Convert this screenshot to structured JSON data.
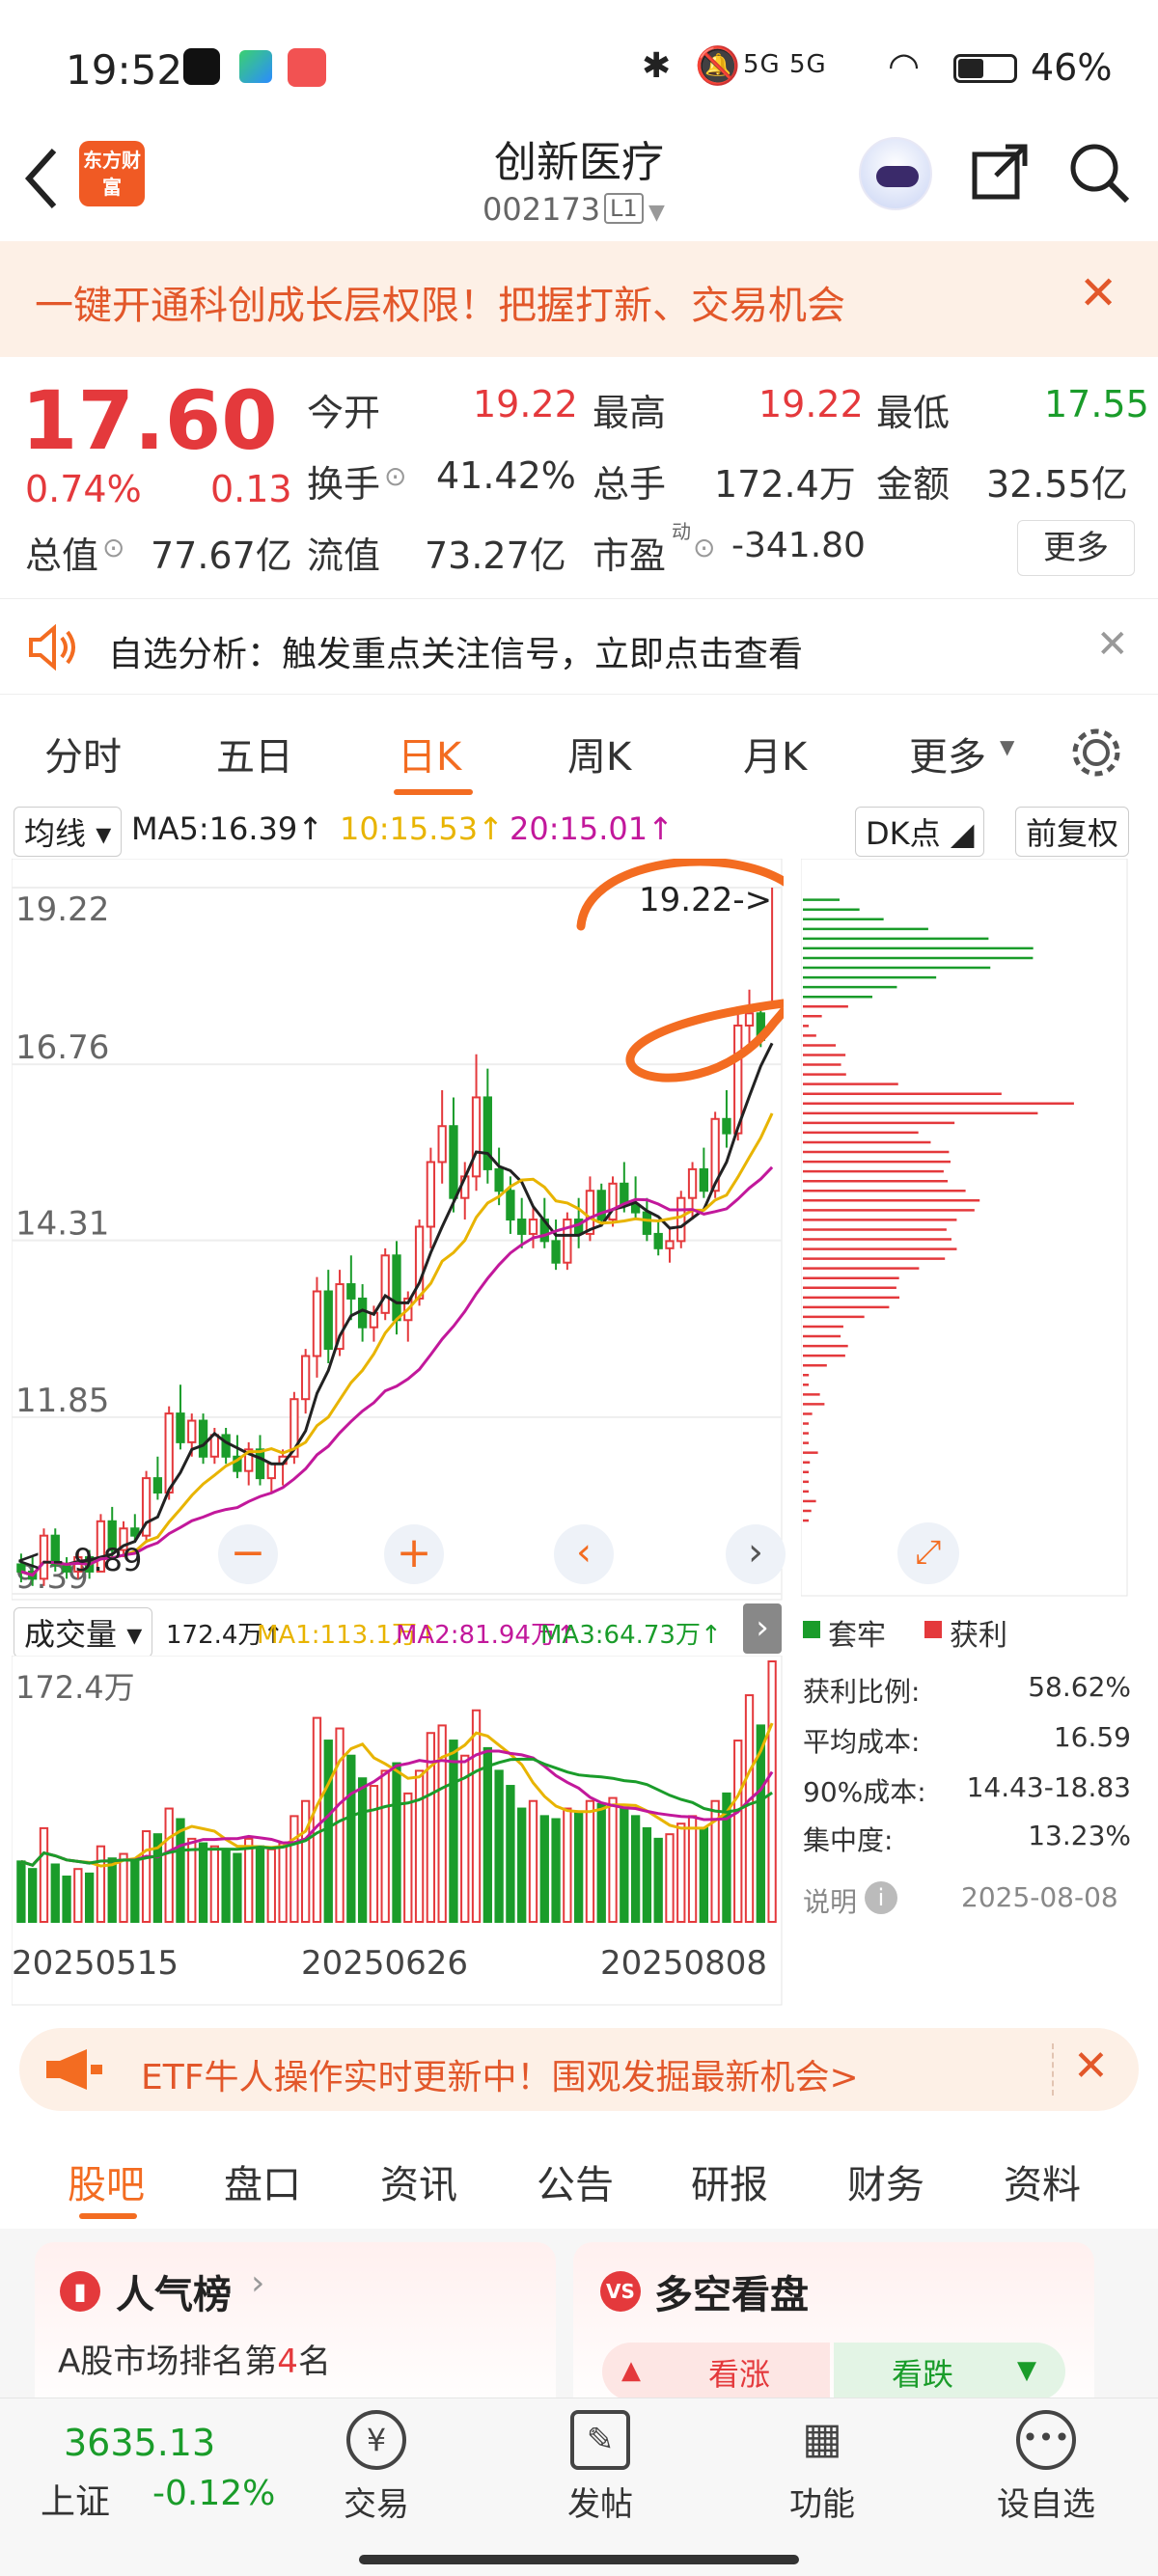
{
  "status_bar": {
    "time": "19:52",
    "network": "5G 5G",
    "battery": "46%"
  },
  "header": {
    "stock_name": "创新医疗",
    "stock_code": "002173",
    "level_badge": "L1",
    "brand_logo_text": "东方财富"
  },
  "promo_banner": {
    "text": "一键开通科创成长层权限！把握打新、交易机会"
  },
  "quote": {
    "price": "17.60",
    "change_pct": "0.74%",
    "change": "0.13",
    "open_label": "今开",
    "open": "19.22",
    "high_label": "最高",
    "high": "19.22",
    "low_label": "最低",
    "low": "17.55",
    "turnover_label": "换手",
    "turnover": "41.42%",
    "volume_label": "总手",
    "volume": "172.4万",
    "amount_label": "金额",
    "amount": "32.55亿",
    "mktcap_label": "总值",
    "mktcap": "77.67亿",
    "float_label": "流值",
    "float_cap": "73.27亿",
    "pe_label": "市盈",
    "pe_sup": "动",
    "pe": "-341.80",
    "more_button": "更多"
  },
  "tip_bar": {
    "text": "自选分析：触发重点关注信号，立即点击查看"
  },
  "period_tabs": {
    "items": [
      "分时",
      "五日",
      "日K",
      "周K",
      "月K",
      "更多"
    ],
    "active": "日K"
  },
  "chart_toolbar": {
    "ma_selector": "均线",
    "ma5": "MA5:16.39↑",
    "ma10": "10:15.53↑",
    "ma20": "20:15.01↑",
    "dk_button": "DK点",
    "adjust_button": "前复权"
  },
  "volume_toolbar": {
    "selector": "成交量",
    "vol": "172.4万↑",
    "ma1": "MA1:113.1万↑",
    "ma2": "MA2:81.94万↑",
    "ma3": "MA3:64.73万↑"
  },
  "price_axis": {
    "labels": [
      "19.22",
      "16.76",
      "14.31",
      "11.85",
      "9.39"
    ],
    "high_marker": "19.22->",
    "low_marker": "9.89"
  },
  "volume_axis": {
    "max_label": "172.4万",
    "dates": [
      "20250515",
      "20250626",
      "20250808"
    ]
  },
  "chip_panel": {
    "legend_trapped": "套牢",
    "legend_profit": "获利",
    "rows": [
      {
        "label": "获利比例:",
        "value": "58.62%"
      },
      {
        "label": "平均成本:",
        "value": "16.59"
      },
      {
        "label": "90%成本:",
        "value": "14.43-18.83"
      },
      {
        "label": "集中度:",
        "value": "13.23%"
      }
    ],
    "note_label": "说明",
    "date": "2025-08-08"
  },
  "etf_banner": {
    "text": "ETF牛人操作实时更新中！围观发掘最新机会>"
  },
  "section_tabs": {
    "items": [
      "股吧",
      "盘口",
      "资讯",
      "公告",
      "研报",
      "财务",
      "资料"
    ],
    "active": "股吧"
  },
  "cards": {
    "popularity_title": "人气榜",
    "popularity_sub_prefix": "A股市场排名第",
    "popularity_rank": "4",
    "popularity_sub_suffix": "名",
    "longshort_title": "多空看盘",
    "bull_label": "看涨",
    "bear_label": "看跌"
  },
  "bottom_bar": {
    "index_value": "3635.13",
    "index_name": "上证",
    "index_change": "-0.12%",
    "items": [
      "交易",
      "发帖",
      "功能",
      "设自选"
    ]
  },
  "colors": {
    "up": "#e4393c",
    "down": "#1a9c2a",
    "accent": "#f36c21",
    "ma5": "#222222",
    "ma10": "#e8b400",
    "ma20": "#c2189b"
  },
  "chart_data": {
    "type": "candlestick",
    "ylim": [
      9.39,
      19.22
    ],
    "candles": [
      [
        9.8,
        9.95,
        9.55,
        9.7
      ],
      [
        9.7,
        9.9,
        9.5,
        9.6
      ],
      [
        9.6,
        10.3,
        9.5,
        10.2
      ],
      [
        10.2,
        10.3,
        9.7,
        9.8
      ],
      [
        9.8,
        9.9,
        9.6,
        9.7
      ],
      [
        9.7,
        10.0,
        9.6,
        9.9
      ],
      [
        9.9,
        10.0,
        9.6,
        9.7
      ],
      [
        9.7,
        10.5,
        9.7,
        10.4
      ],
      [
        10.4,
        10.6,
        9.9,
        10.0
      ],
      [
        10.0,
        10.4,
        9.9,
        10.3
      ],
      [
        10.3,
        10.5,
        10.1,
        10.2
      ],
      [
        10.2,
        11.1,
        10.1,
        11.0
      ],
      [
        11.0,
        11.3,
        10.7,
        10.8
      ],
      [
        10.8,
        12.0,
        10.7,
        11.9
      ],
      [
        11.9,
        12.3,
        11.4,
        11.5
      ],
      [
        11.5,
        11.9,
        11.3,
        11.8
      ],
      [
        11.8,
        11.9,
        11.2,
        11.3
      ],
      [
        11.3,
        11.7,
        11.2,
        11.6
      ],
      [
        11.6,
        11.7,
        11.2,
        11.3
      ],
      [
        11.3,
        11.6,
        11.0,
        11.1
      ],
      [
        11.1,
        11.5,
        10.9,
        11.4
      ],
      [
        11.4,
        11.6,
        10.9,
        11.0
      ],
      [
        11.0,
        11.2,
        10.8,
        11.2
      ],
      [
        11.2,
        11.4,
        10.9,
        11.3
      ],
      [
        11.3,
        12.2,
        11.2,
        12.1
      ],
      [
        12.1,
        12.8,
        11.9,
        12.7
      ],
      [
        12.7,
        13.8,
        12.4,
        13.6
      ],
      [
        13.6,
        13.9,
        12.6,
        12.8
      ],
      [
        12.8,
        13.9,
        12.7,
        13.7
      ],
      [
        13.7,
        14.1,
        13.2,
        13.5
      ],
      [
        13.5,
        13.7,
        12.9,
        13.1
      ],
      [
        13.1,
        13.4,
        12.9,
        13.3
      ],
      [
        13.3,
        14.2,
        13.2,
        14.1
      ],
      [
        14.1,
        14.3,
        13.0,
        13.2
      ],
      [
        13.2,
        13.6,
        12.9,
        13.5
      ],
      [
        13.5,
        14.6,
        13.4,
        14.5
      ],
      [
        14.5,
        15.6,
        14.2,
        15.4
      ],
      [
        15.4,
        16.4,
        15.1,
        15.9
      ],
      [
        15.9,
        16.3,
        14.7,
        14.9
      ],
      [
        14.9,
        15.4,
        14.6,
        15.2
      ],
      [
        15.2,
        16.9,
        15.0,
        16.3
      ],
      [
        16.3,
        16.7,
        15.1,
        15.3
      ],
      [
        15.3,
        15.6,
        14.8,
        15.0
      ],
      [
        15.0,
        15.2,
        14.4,
        14.6
      ],
      [
        14.6,
        14.9,
        14.2,
        14.4
      ],
      [
        14.4,
        14.8,
        14.2,
        14.6
      ],
      [
        14.6,
        14.9,
        14.2,
        14.3
      ],
      [
        14.3,
        14.6,
        13.9,
        14.0
      ],
      [
        14.0,
        14.7,
        13.9,
        14.6
      ],
      [
        14.6,
        14.9,
        14.2,
        14.4
      ],
      [
        14.4,
        15.2,
        14.3,
        15.0
      ],
      [
        15.0,
        15.1,
        14.5,
        14.6
      ],
      [
        14.6,
        15.2,
        14.5,
        15.1
      ],
      [
        15.1,
        15.4,
        14.7,
        14.8
      ],
      [
        14.8,
        15.2,
        14.6,
        14.7
      ],
      [
        14.7,
        14.9,
        14.3,
        14.4
      ],
      [
        14.4,
        14.6,
        14.1,
        14.2
      ],
      [
        14.2,
        14.5,
        14.0,
        14.3
      ],
      [
        14.3,
        15.0,
        14.2,
        14.9
      ],
      [
        14.9,
        15.4,
        14.6,
        15.3
      ],
      [
        15.3,
        15.6,
        14.9,
        15.0
      ],
      [
        15.0,
        16.1,
        14.9,
        16.0
      ],
      [
        16.0,
        16.4,
        15.6,
        15.8
      ],
      [
        15.8,
        17.5,
        15.7,
        17.3
      ],
      [
        17.3,
        17.8,
        17.0,
        17.47
      ],
      [
        17.47,
        17.6,
        17.0,
        17.1
      ],
      [
        17.55,
        19.22,
        17.55,
        17.6
      ]
    ],
    "volume": [
      40,
      35,
      62,
      38,
      30,
      35,
      32,
      50,
      42,
      45,
      40,
      60,
      58,
      75,
      68,
      55,
      52,
      50,
      48,
      45,
      55,
      50,
      48,
      52,
      70,
      80,
      135,
      120,
      128,
      110,
      95,
      90,
      100,
      105,
      85,
      100,
      125,
      130,
      120,
      110,
      140,
      115,
      100,
      90,
      75,
      80,
      70,
      68,
      75,
      72,
      80,
      78,
      82,
      75,
      70,
      62,
      55,
      58,
      65,
      70,
      62,
      80,
      85,
      120,
      150,
      130,
      172.4
    ],
    "ma_series": [
      {
        "name": "MA5",
        "value": "16.39"
      },
      {
        "name": "MA10",
        "value": "15.53"
      },
      {
        "name": "MA20",
        "value": "15.01"
      }
    ]
  }
}
